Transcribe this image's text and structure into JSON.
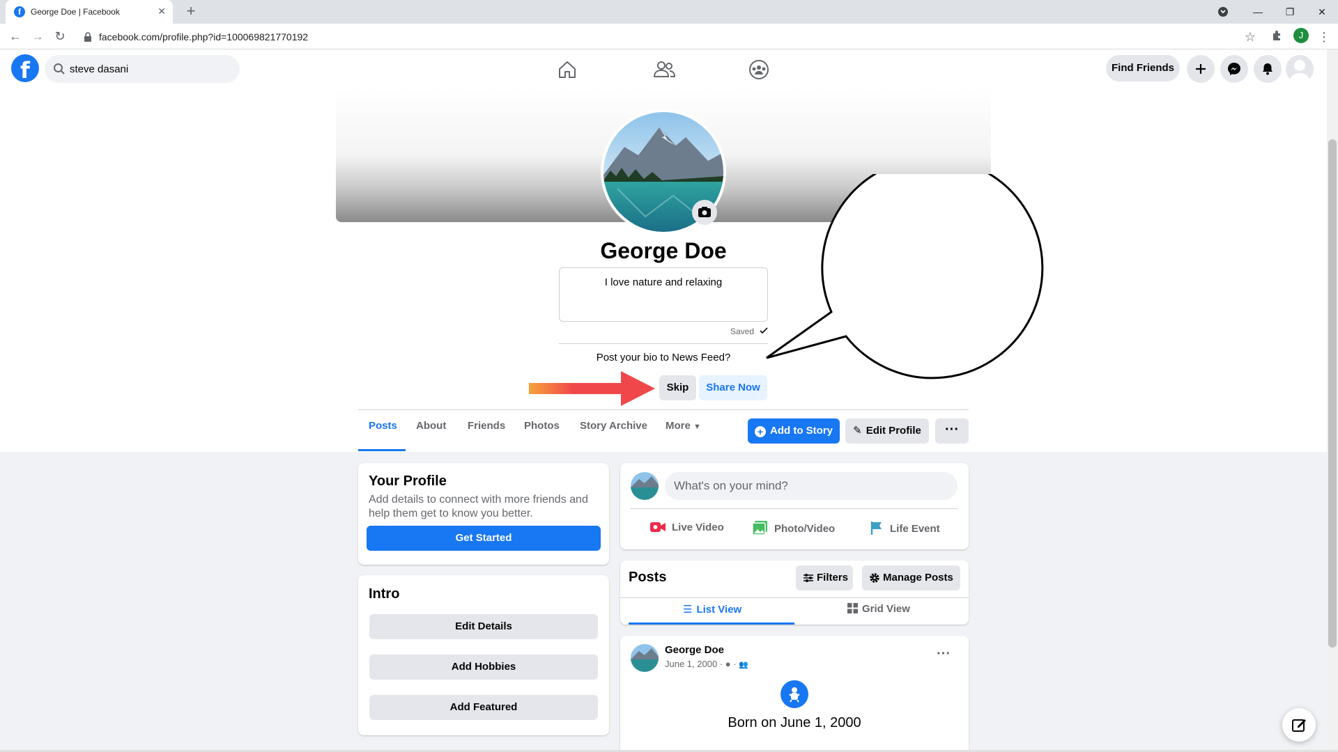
{
  "browser": {
    "tab_title": "George Doe | Facebook",
    "url": "facebook.com/profile.php?id=100069821770192",
    "profile_initial": "J"
  },
  "fb": {
    "search_value": "steve dasani",
    "find_friends": "Find Friends"
  },
  "profile": {
    "name": "George Doe",
    "bio": "I love nature and relaxing",
    "saved": "Saved",
    "post_question": "Post your bio to News Feed?",
    "skip": "Skip",
    "share_now": "Share Now"
  },
  "tabs": [
    "Posts",
    "About",
    "Friends",
    "Photos",
    "Story Archive",
    "More"
  ],
  "actions": {
    "add_to_story": "Add to Story",
    "edit_profile": "Edit Profile",
    "more": "···"
  },
  "your_profile": {
    "title": "Your Profile",
    "desc": "Add details to connect with more friends and help them get to know you better.",
    "cta": "Get Started"
  },
  "intro": {
    "title": "Intro",
    "buttons": [
      "Edit Details",
      "Add Hobbies",
      "Add Featured"
    ]
  },
  "composer": {
    "placeholder": "What's on your mind?",
    "actions": [
      "Live Video",
      "Photo/Video",
      "Life Event"
    ]
  },
  "posts_header": {
    "title": "Posts",
    "filters": "Filters",
    "manage": "Manage Posts",
    "list_view": "List View",
    "grid_view": "Grid View"
  },
  "post": {
    "author": "George Doe",
    "date": "June 1, 2000 ·",
    "event": "Born on June 1, 2000"
  },
  "colors": {
    "brand": "#1877f2",
    "arrow": "#f0484a"
  }
}
